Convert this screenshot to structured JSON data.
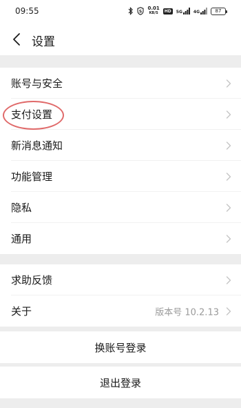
{
  "status_bar": {
    "time": "09:55",
    "speed_value": "0.01",
    "speed_unit": "KB/S",
    "hd_label": "HD",
    "net_5g": "5G",
    "net_4g": "4G",
    "battery": "87"
  },
  "header": {
    "title": "设置"
  },
  "group1": [
    {
      "label": "账号与安全"
    },
    {
      "label": "支付设置"
    },
    {
      "label": "新消息通知"
    },
    {
      "label": "功能管理"
    },
    {
      "label": "隐私"
    },
    {
      "label": "通用"
    }
  ],
  "group2": [
    {
      "label": "求助反馈"
    },
    {
      "label": "关于",
      "value": "版本号 10.2.13"
    }
  ],
  "actions": {
    "switch_account": "换账号登录",
    "logout": "退出登录"
  },
  "colors": {
    "background": "#ededed",
    "card": "#ffffff",
    "highlight_ring": "#e06a6a",
    "secondary_text": "#9a9a9a"
  }
}
